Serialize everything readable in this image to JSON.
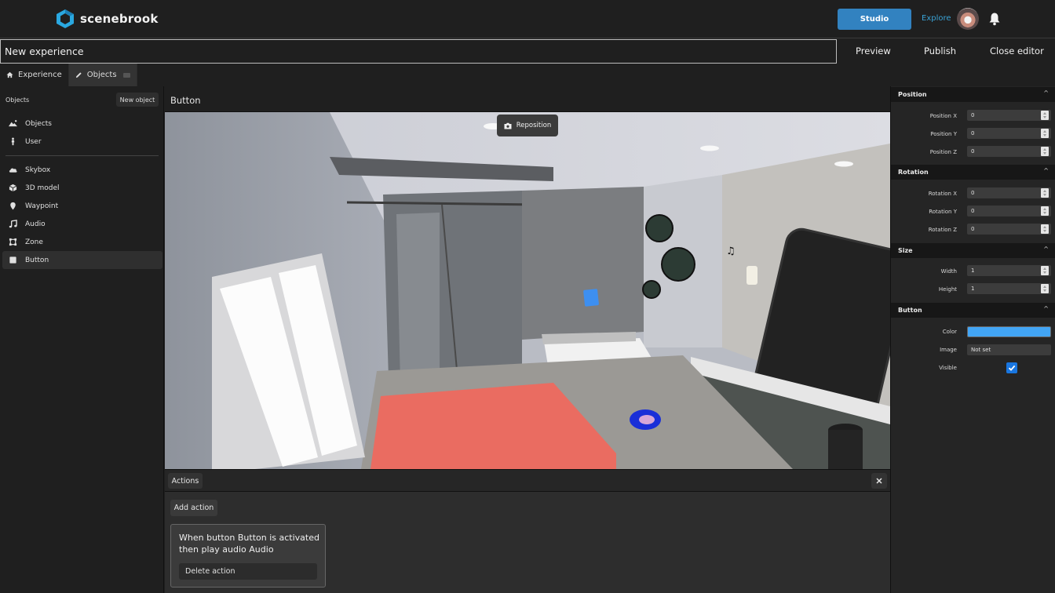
{
  "app": {
    "brand": "scenebrook",
    "brand_color": "#2aa8e0"
  },
  "header": {
    "studio_label": "Studio",
    "explore_label": "Explore",
    "avatar_icon": "user-avatar",
    "notification_icon": "bell-icon"
  },
  "title_bar": {
    "experience_name": "New experience",
    "preview_label": "Preview",
    "publish_label": "Publish",
    "close_label": "Close editor"
  },
  "tabs": [
    {
      "label": "Experience",
      "icon": "home-icon",
      "active": false
    },
    {
      "label": "Objects",
      "icon": "pencil-icon",
      "active": true
    }
  ],
  "left_panel": {
    "header": "Objects",
    "new_object_label": "New object",
    "top_items": [
      {
        "label": "Objects",
        "icon": "landscape-icon"
      },
      {
        "label": "User",
        "icon": "person-icon"
      }
    ],
    "items": [
      {
        "label": "Skybox",
        "icon": "cloud-icon",
        "selected": false
      },
      {
        "label": "3D model",
        "icon": "cube-icon",
        "selected": false
      },
      {
        "label": "Waypoint",
        "icon": "pin-icon",
        "selected": false
      },
      {
        "label": "Audio",
        "icon": "music-note-icon",
        "selected": false
      },
      {
        "label": "Zone",
        "icon": "zone-icon",
        "selected": false
      },
      {
        "label": "Button",
        "icon": "square-icon",
        "selected": true
      }
    ]
  },
  "center": {
    "title": "Button",
    "reposition_label": "Reposition"
  },
  "actions": {
    "tab_label": "Actions",
    "add_label": "Add action",
    "cards": [
      {
        "text": "When button Button is activated then play audio Audio",
        "delete_label": "Delete action"
      }
    ]
  },
  "properties": {
    "position": {
      "title": "Position",
      "fields": [
        {
          "label": "Position X",
          "value": "0"
        },
        {
          "label": "Position Y",
          "value": "0"
        },
        {
          "label": "Position Z",
          "value": "0"
        }
      ]
    },
    "rotation": {
      "title": "Rotation",
      "fields": [
        {
          "label": "Rotation X",
          "value": "0"
        },
        {
          "label": "Rotation Y",
          "value": "0"
        },
        {
          "label": "Rotation Z",
          "value": "0"
        }
      ]
    },
    "size": {
      "title": "Size",
      "fields": [
        {
          "label": "Width",
          "value": "1"
        },
        {
          "label": "Height",
          "value": "1"
        }
      ]
    },
    "button": {
      "title": "Button",
      "color_label": "Color",
      "color_value": "#42a5f5",
      "image_label": "Image",
      "image_value": "Not set",
      "visible_label": "Visible",
      "visible": true
    },
    "collapse_glyph": "^"
  }
}
